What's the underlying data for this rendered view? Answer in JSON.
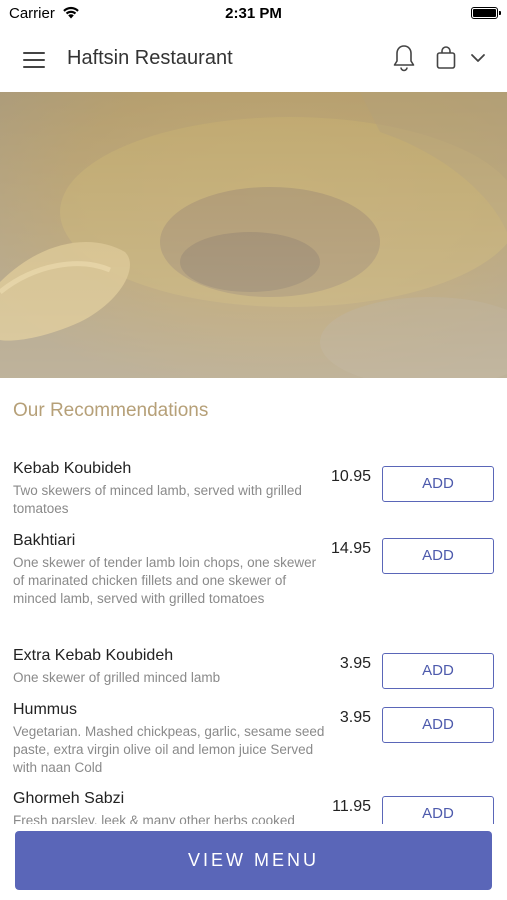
{
  "status_bar": {
    "carrier": "Carrier",
    "time": "2:31 PM"
  },
  "header": {
    "title": "Haftsin Restaurant"
  },
  "section": {
    "title": "Our Recommendations"
  },
  "add_label": "ADD",
  "items": [
    {
      "name": "Kebab Koubideh",
      "desc": "Two skewers of minced lamb, served with grilled tomatoes",
      "price": "10.95"
    },
    {
      "name": "Bakhtiari",
      "desc": "One skewer of tender lamb loin chops, one skewer of marinated chicken fillets and one skewer of minced lamb, served with grilled tomatoes",
      "price": "14.95"
    },
    {
      "name": "Extra Kebab Koubideh",
      "desc": "One skewer of grilled minced lamb",
      "price": "3.95"
    },
    {
      "name": "Hummus",
      "desc": "Vegetarian. Mashed chickpeas, garlic, sesame seed paste, extra virgin olive oil and lemon juice Served with naan Cold",
      "price": "3.95"
    },
    {
      "name": "Ghormeh Sabzi",
      "desc": "Fresh parsley, leek & many other herbs cooked",
      "price": "11.95"
    }
  ],
  "footer": {
    "view_menu_label": "VIEW MENU"
  },
  "colors": {
    "accent": "#5a66b8",
    "section_title": "#b6a078"
  }
}
